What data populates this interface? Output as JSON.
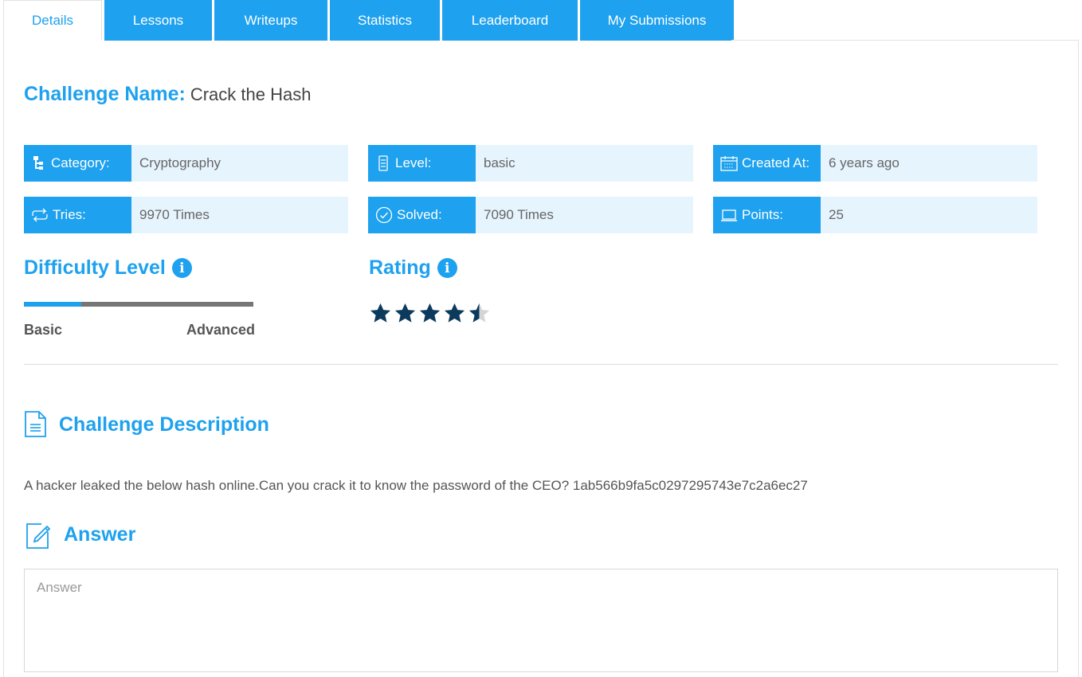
{
  "tabs": [
    {
      "label": "Details"
    },
    {
      "label": "Lessons"
    },
    {
      "label": "Writeups"
    },
    {
      "label": "Statistics"
    },
    {
      "label": "Leaderboard"
    },
    {
      "label": "My Submissions"
    }
  ],
  "challenge": {
    "name_label": "Challenge Name:",
    "name": "Crack the Hash"
  },
  "info": {
    "category": {
      "label": "Category:",
      "value": "Cryptography",
      "icon": "sitemap-icon"
    },
    "level": {
      "label": "Level:",
      "value": "basic",
      "icon": "level-icon"
    },
    "created": {
      "label": "Created At:",
      "value": "6 years ago",
      "icon": "calendar-icon"
    },
    "tries": {
      "label": "Tries:",
      "value": "9970 Times",
      "icon": "repeat-icon"
    },
    "solved": {
      "label": "Solved:",
      "value": "7090 Times",
      "icon": "check-circle-icon"
    },
    "points": {
      "label": "Points:",
      "value": "25",
      "icon": "laptop-icon"
    }
  },
  "difficulty": {
    "title": "Difficulty Level",
    "min_label": "Basic",
    "max_label": "Advanced",
    "level_fraction": 0.25
  },
  "rating": {
    "title": "Rating",
    "value": 4.5,
    "max": 5
  },
  "description": {
    "title": "Challenge Description",
    "text": "A hacker leaked the below hash online.Can you crack it to know the password of the CEO? 1ab566b9fa5c0297295743e7c2a6ec27"
  },
  "answer": {
    "title": "Answer",
    "placeholder": "Answer"
  },
  "colors": {
    "accent": "#1ea1ee",
    "star": "#0b3a5c",
    "star_empty": "#d5d5d5",
    "info_bg": "#e6f4fd"
  }
}
